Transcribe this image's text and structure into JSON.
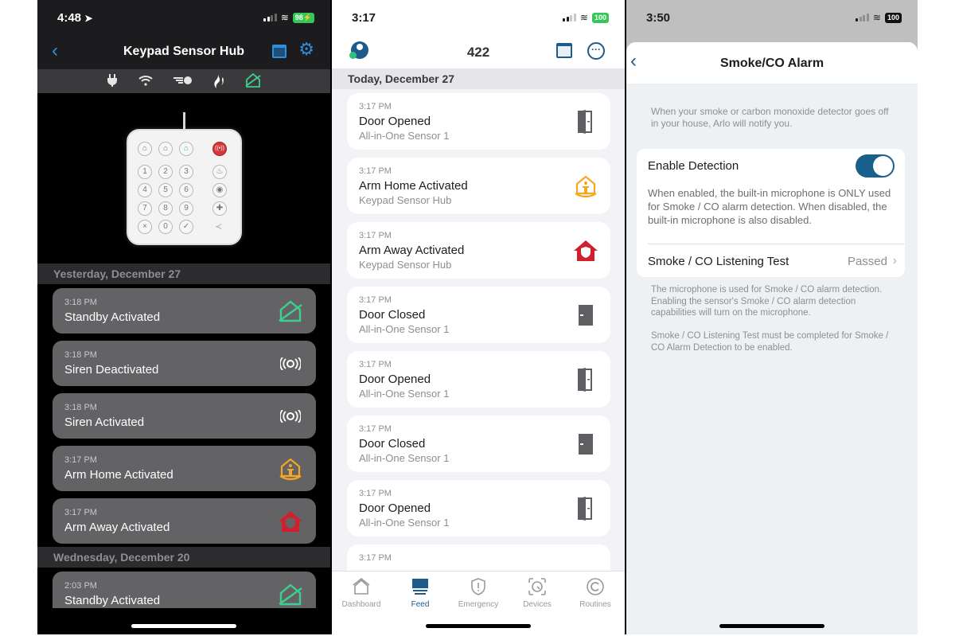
{
  "panel1": {
    "status": {
      "time": "4:48",
      "battery": "98",
      "location_icon": "location-arrow-icon",
      "charging": true
    },
    "nav": {
      "back_icon": "chevron-left-icon",
      "title": "Keypad Sensor Hub",
      "calendar_icon": "calendar-icon",
      "settings_icon": "gear-icon"
    },
    "status_icons": [
      "power-plug-icon",
      "wifi-icon",
      "motion-icon",
      "smoke-flame-icon",
      "standby-home-icon"
    ],
    "keypad": {
      "mode_keys": [
        "home-icon",
        "arm-home-icon",
        "standby-icon"
      ],
      "panic_key": "siren-icon",
      "number_keys": [
        "1",
        "2",
        "3",
        "4",
        "5",
        "6",
        "7",
        "8",
        "9",
        "×",
        "0",
        "✓"
      ],
      "side_keys": [
        "fire-icon",
        "police-icon",
        "medical-icon"
      ],
      "logo": "arlo-logo"
    },
    "sections": [
      {
        "label": "Yesterday, December 27",
        "events": [
          {
            "time": "3:18 PM",
            "name": "Standby Activated",
            "icon": "standby-home-icon"
          },
          {
            "time": "3:18 PM",
            "name": "Siren Deactivated",
            "icon": "siren-icon"
          },
          {
            "time": "3:18 PM",
            "name": "Siren Activated",
            "icon": "siren-icon"
          },
          {
            "time": "3:17 PM",
            "name": "Arm Home Activated",
            "icon": "arm-home-icon"
          },
          {
            "time": "3:17 PM",
            "name": "Arm Away Activated",
            "icon": "arm-away-icon"
          }
        ]
      },
      {
        "label": "Wednesday, December 20",
        "events": [
          {
            "time": "2:03 PM",
            "name": "Standby Activated",
            "icon": "standby-home-icon"
          }
        ]
      }
    ]
  },
  "panel2": {
    "status": {
      "time": "3:17",
      "battery": "100"
    },
    "nav": {
      "avatar_icon": "user-avatar-icon",
      "count": "422",
      "calendar_icon": "calendar-icon",
      "more_icon": "more-options-icon"
    },
    "section": "Today, December 27",
    "events": [
      {
        "time": "3:17 PM",
        "name": "Door Opened",
        "device": "All-in-One Sensor 1",
        "icon": "door-open-icon"
      },
      {
        "time": "3:17 PM",
        "name": "Arm Home Activated",
        "device": "Keypad Sensor Hub",
        "icon": "arm-home-icon"
      },
      {
        "time": "3:17 PM",
        "name": "Arm Away Activated",
        "device": "Keypad Sensor Hub",
        "icon": "arm-away-icon"
      },
      {
        "time": "3:17 PM",
        "name": "Door Closed",
        "device": "All-in-One Sensor 1",
        "icon": "door-closed-icon"
      },
      {
        "time": "3:17 PM",
        "name": "Door Opened",
        "device": "All-in-One Sensor 1",
        "icon": "door-open-icon"
      },
      {
        "time": "3:17 PM",
        "name": "Door Closed",
        "device": "All-in-One Sensor 1",
        "icon": "door-closed-icon"
      },
      {
        "time": "3:17 PM",
        "name": "Door Opened",
        "device": "All-in-One Sensor 1",
        "icon": "door-open-icon"
      },
      {
        "time": "3:17 PM",
        "name": "",
        "device": "",
        "icon": "motion-icon"
      }
    ],
    "tabs": [
      {
        "label": "Dashboard",
        "icon": "home-icon",
        "active": false
      },
      {
        "label": "Feed",
        "icon": "feed-icon",
        "active": true
      },
      {
        "label": "Emergency",
        "icon": "shield-alert-icon",
        "active": false
      },
      {
        "label": "Devices",
        "icon": "camera-device-icon",
        "active": false
      },
      {
        "label": "Routines",
        "icon": "routines-icon",
        "active": false
      }
    ]
  },
  "panel3": {
    "status": {
      "time": "3:50",
      "battery": "100"
    },
    "nav": {
      "back_icon": "chevron-left-icon",
      "title": "Smoke/CO Alarm"
    },
    "description": "When your smoke or carbon monoxide detector goes off in your house, Arlo will notify you.",
    "enable_detection": {
      "label": "Enable Detection",
      "enabled": true,
      "help": "When enabled, the built-in microphone is ONLY used for Smoke / CO alarm detection. When disabled, the built-in microphone is also disabled."
    },
    "listening_test": {
      "label": "Smoke / CO Listening Test",
      "value": "Passed"
    },
    "footnotes": [
      "The microphone is used for Smoke / CO alarm detection. Enabling the sensor's Smoke / CO alarm detection capabilities will turn on the microphone.",
      "Smoke / CO Listening Test must be completed for Smoke / CO Alarm Detection to be enabled."
    ]
  },
  "colors": {
    "accent_blue": "#2f8fd8",
    "arlo_blue": "#1e5a8a",
    "standby_green": "#3ecf8e",
    "arm_home_orange": "#f5a623",
    "arm_away_red": "#d0202e",
    "battery_green": "#34c759"
  }
}
